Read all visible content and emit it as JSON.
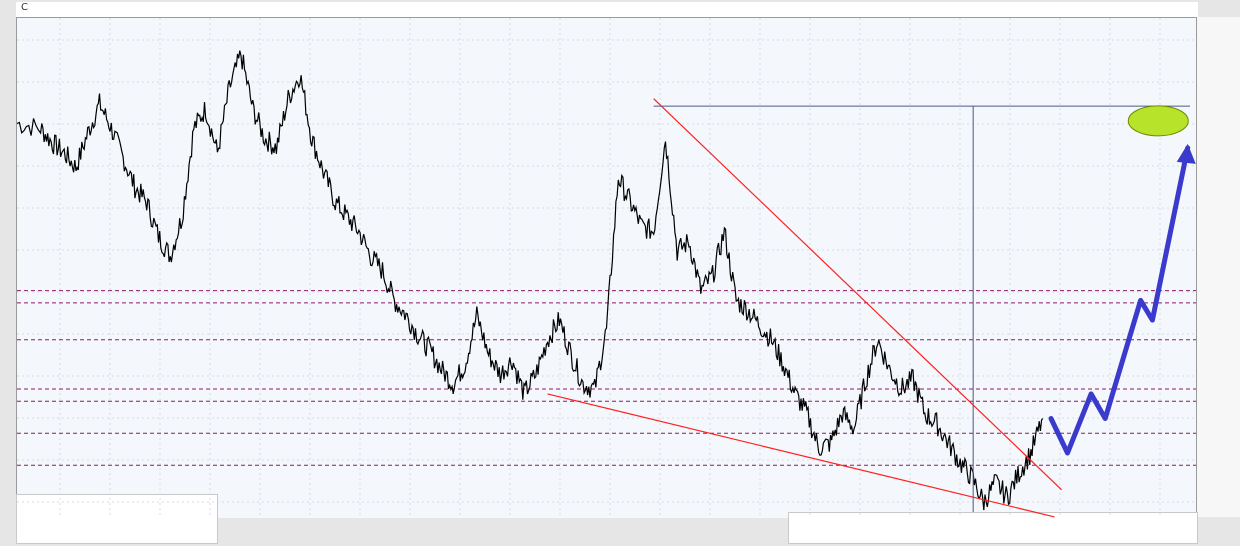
{
  "window": {
    "title_char": "C",
    "background": "#e6e6e6",
    "plot_background": "#f4f7fb"
  },
  "chart_data": {
    "type": "line",
    "title": "",
    "xlabel": "",
    "ylabel": "",
    "grid": true,
    "legend": "none",
    "xlim": [
      0,
      100
    ],
    "ylim": [
      0,
      100
    ],
    "series": [
      {
        "color": "#000000",
        "points": [
          [
            0,
            79
          ],
          [
            2,
            78
          ],
          [
            3,
            75
          ],
          [
            4,
            73
          ],
          [
            5,
            70
          ],
          [
            6,
            77
          ],
          [
            7,
            83
          ],
          [
            8,
            78
          ],
          [
            9,
            72
          ],
          [
            10,
            66
          ],
          [
            11,
            63
          ],
          [
            12,
            56
          ],
          [
            13,
            52
          ],
          [
            14,
            60
          ],
          [
            15,
            78
          ],
          [
            16,
            82
          ],
          [
            17,
            73
          ],
          [
            18,
            86
          ],
          [
            19,
            93
          ],
          [
            20,
            82
          ],
          [
            21,
            76
          ],
          [
            22,
            74
          ],
          [
            23,
            84
          ],
          [
            24,
            89
          ],
          [
            25,
            76
          ],
          [
            26,
            69
          ],
          [
            27,
            63
          ],
          [
            28,
            60
          ],
          [
            29,
            57
          ],
          [
            30,
            52
          ],
          [
            31,
            49
          ],
          [
            32,
            43
          ],
          [
            33,
            40
          ],
          [
            34,
            36
          ],
          [
            35,
            33
          ],
          [
            36,
            29
          ],
          [
            37,
            26
          ],
          [
            38,
            30
          ],
          [
            39,
            40
          ],
          [
            40,
            32
          ],
          [
            41,
            28
          ],
          [
            42,
            31
          ],
          [
            43,
            24
          ],
          [
            44,
            28
          ],
          [
            45,
            35
          ],
          [
            46,
            39
          ],
          [
            47,
            32
          ],
          [
            48,
            26
          ],
          [
            49,
            25
          ],
          [
            50,
            37
          ],
          [
            51,
            68
          ],
          [
            52,
            63
          ],
          [
            53,
            58
          ],
          [
            54,
            57
          ],
          [
            55,
            76
          ],
          [
            56,
            53
          ],
          [
            57,
            55
          ],
          [
            58,
            45
          ],
          [
            59,
            48
          ],
          [
            60,
            57
          ],
          [
            61,
            43
          ],
          [
            62,
            41
          ],
          [
            63,
            38
          ],
          [
            64,
            35
          ],
          [
            65,
            30
          ],
          [
            66,
            24
          ],
          [
            67,
            20
          ],
          [
            68,
            13
          ],
          [
            69,
            14
          ],
          [
            70,
            20
          ],
          [
            71,
            17
          ],
          [
            72,
            27
          ],
          [
            73,
            35
          ],
          [
            74,
            29
          ],
          [
            75,
            25
          ],
          [
            76,
            27
          ],
          [
            77,
            20
          ],
          [
            78,
            18
          ],
          [
            79,
            14
          ],
          [
            80,
            10
          ],
          [
            81,
            7
          ],
          [
            82,
            2
          ],
          [
            83,
            6
          ],
          [
            84,
            3
          ],
          [
            85,
            8
          ],
          [
            86,
            12
          ],
          [
            87,
            19
          ]
        ]
      }
    ],
    "horizontal_levels": [
      45,
      42.5,
      35,
      25,
      22.5,
      16,
      9.5
    ],
    "resistance_level": 82.5,
    "annotations": {
      "resistance_line_color": "#ff2020",
      "support_line_color": "#ff2020",
      "level_line_color": "#8b1a6b",
      "projection_color": "#3a3acc",
      "target_color": "#b7e32a",
      "vertical_marker_color": "#4a5a8a",
      "horizontal_marker_color": "#4a5a8a"
    }
  }
}
